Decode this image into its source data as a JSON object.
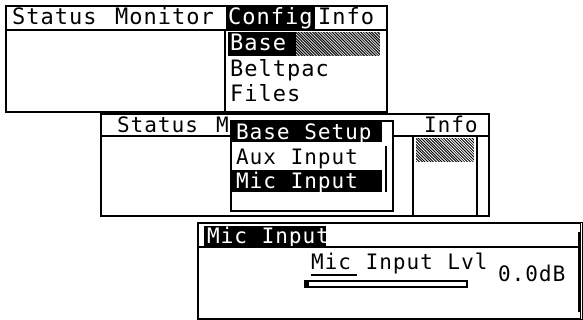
{
  "screen1": {
    "menu": [
      "Status",
      "Monitor",
      "Config",
      "Info"
    ],
    "dropdown": [
      "Base",
      "Beltpac",
      "Files"
    ]
  },
  "screen2": {
    "menu": [
      "Status",
      "M",
      "Info"
    ],
    "submenu_title": "Base Setup",
    "submenu_items": [
      "Aux Input",
      "Mic Input"
    ]
  },
  "screen3": {
    "title": "Mic Input",
    "param_label": "Mic Input Lvl",
    "value": "0.0dB",
    "level_fraction": 0.02
  }
}
